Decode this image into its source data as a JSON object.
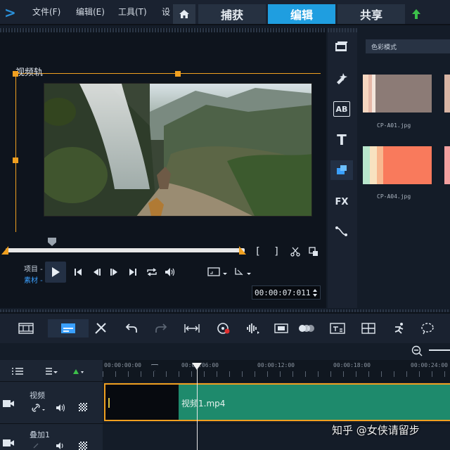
{
  "menu": [
    "文件(F)",
    "编辑(E)",
    "工具(T)",
    "设"
  ],
  "tabs": [
    {
      "label": "捕获",
      "active": false
    },
    {
      "label": "编辑",
      "active": true
    },
    {
      "label": "共享",
      "active": false
    }
  ],
  "player": {
    "track_label": "视频轨",
    "mode_project": "项目 -",
    "mode_clip": "素材 -",
    "timecode": "00:00:07:011",
    "mark_in": "[",
    "mark_out": "]"
  },
  "library": {
    "select_label": "色彩模式",
    "tools": [
      {
        "icon": "media-icon"
      },
      {
        "icon": "instant-project-icon"
      },
      {
        "icon": "transition-icon",
        "text": "AB"
      },
      {
        "icon": "title-icon",
        "text": "T"
      },
      {
        "icon": "graphics-icon"
      },
      {
        "icon": "filter-icon",
        "text": "FX"
      },
      {
        "icon": "path-icon"
      }
    ],
    "thumbnails": [
      {
        "label": "CP-A01.jpg",
        "colors": [
          "#f6d6c0",
          "#e6b8a8",
          "#f4e6dc",
          "#8c7b76"
        ]
      },
      {
        "label": "CP-A04.jpg",
        "colors": [
          "#b8e6cc",
          "#f8e2c0",
          "#f8b890",
          "#f97a5c"
        ]
      }
    ]
  },
  "timeline": {
    "ruler_ticks": [
      "00:00:00:00",
      "00:00:06:00",
      "00:00:12:00",
      "00:00:18:00",
      "00:00:24:00"
    ],
    "tracks": [
      {
        "name": "视频"
      },
      {
        "name": "叠加1"
      }
    ],
    "clip_name": "视频1.mp4"
  },
  "watermark": "知乎 @女侠请留步",
  "colors": {
    "accent": "#1f9ee0",
    "clip": "#1e8a6c",
    "trim": "#f0a020"
  }
}
